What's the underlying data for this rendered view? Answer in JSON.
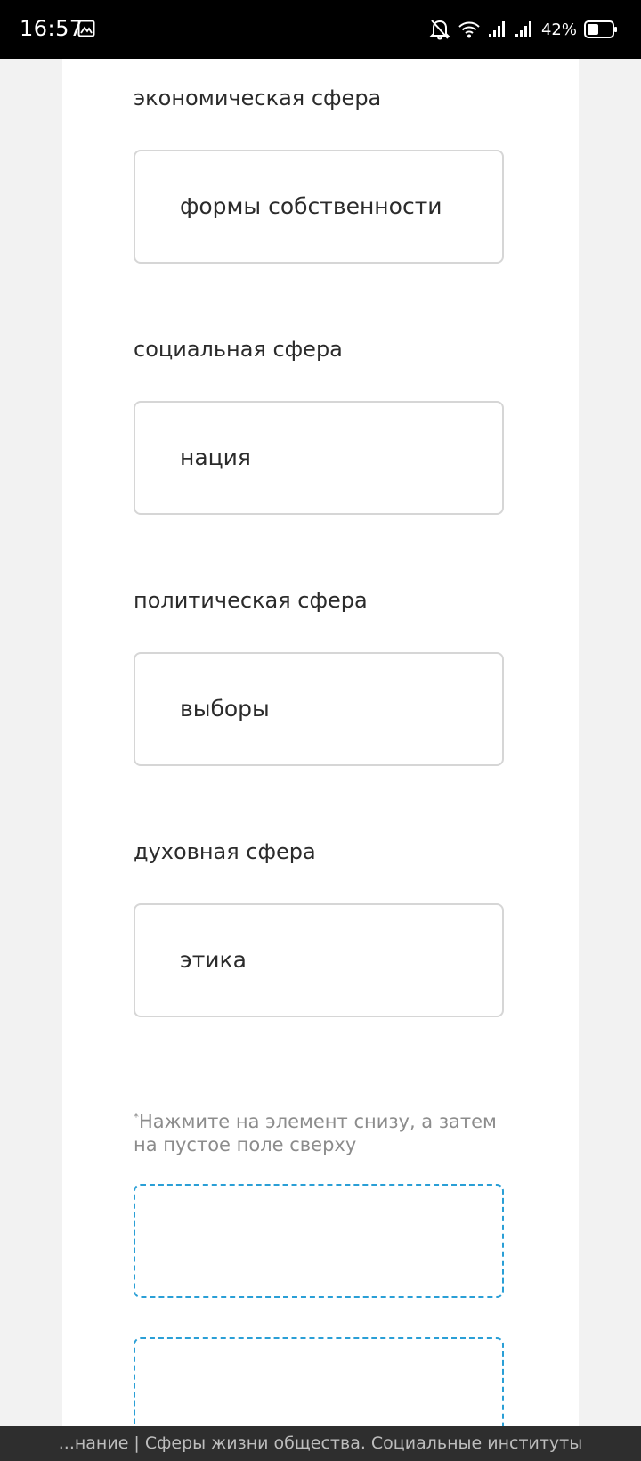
{
  "status_bar": {
    "time": "16:57",
    "battery": "42%",
    "icons": [
      "gallery-icon",
      "bell-off-icon",
      "wifi-icon",
      "signal-icon",
      "signal-icon",
      "battery-icon"
    ]
  },
  "spheres": [
    {
      "label": "экономическая сфера",
      "answer": "формы собственности"
    },
    {
      "label": "социальная сфера",
      "answer": "нация"
    },
    {
      "label": "политическая сфера",
      "answer": "выборы"
    },
    {
      "label": "духовная сфера",
      "answer": "этика"
    }
  ],
  "hint": {
    "marker": "*",
    "text": "Нажмите на элемент снизу, а затем на пустое поле сверху"
  },
  "page_title": "...нание | Сферы жизни общества. Социальные институты",
  "colors": {
    "accent": "#2a9fd6",
    "border": "#d6d6d6",
    "text": "#2b2b2b",
    "hint": "#8c8c8c"
  }
}
